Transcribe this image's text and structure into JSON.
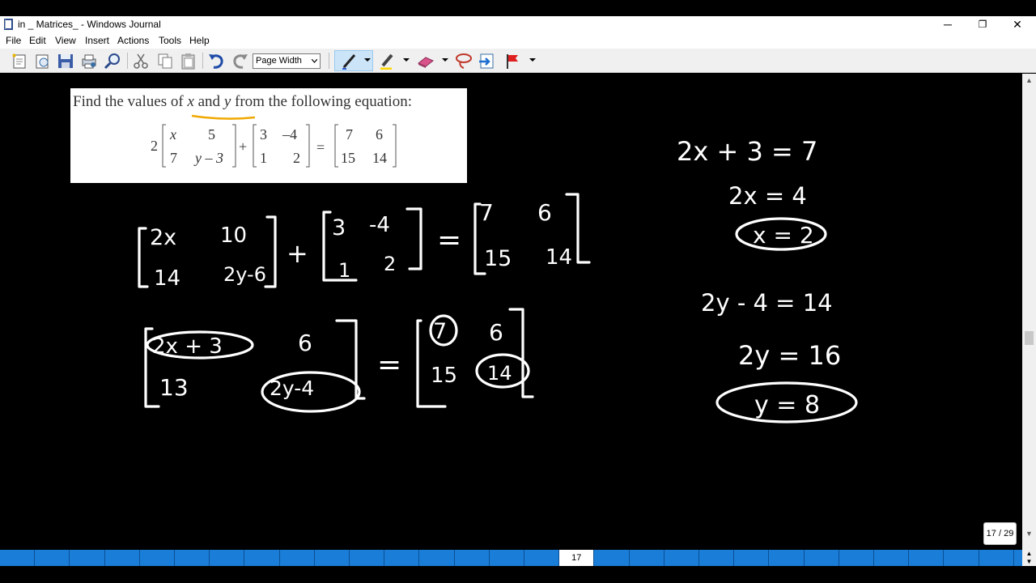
{
  "window": {
    "title": "in _ Matrices_ - Windows Journal",
    "minimize": "─",
    "restore": "❐",
    "close": "✕"
  },
  "menu": [
    "File",
    "Edit",
    "View",
    "Insert",
    "Actions",
    "Tools",
    "Help"
  ],
  "toolbar": {
    "zoom_value": "Page Width",
    "icons": [
      "new-note-icon",
      "open-icon",
      "save-icon",
      "print-icon",
      "find-icon",
      "cut-icon",
      "copy-icon",
      "paste-icon",
      "undo-icon",
      "redo-icon",
      "pen-icon",
      "highlighter-icon",
      "eraser-icon",
      "lasso-icon",
      "insert-space-icon",
      "flag-icon"
    ],
    "colors": {
      "pen_active_bg": "#cce4f7",
      "highlighter": "#ffd700",
      "eraser": "#d9538a",
      "lasso": "#c0392b",
      "flag": "#e02020"
    }
  },
  "problem": {
    "prompt_pre": "Find the values of ",
    "var_x": "x",
    "and": " and ",
    "var_y": "y",
    "prompt_post": " from the following equation:",
    "scalar": "2",
    "m1": [
      "x",
      "5",
      "7",
      "y – 3"
    ],
    "plus": "+",
    "m2": [
      "3",
      "–4",
      "1",
      "2"
    ],
    "equals": "=",
    "m3": [
      "7",
      "6",
      "15",
      "14"
    ]
  },
  "handwriting": {
    "line1": {
      "a": [
        "2x",
        "10",
        "14",
        "2y-6"
      ],
      "plus": "+",
      "b": [
        "3",
        "-4",
        "1",
        "2"
      ],
      "equals": "=",
      "c": [
        "7",
        "6",
        "15",
        "14"
      ]
    },
    "line2": {
      "a": [
        "2x + 3",
        "6",
        "13",
        "2y-4"
      ],
      "equals": "=",
      "c": [
        "7",
        "6",
        "15",
        "14"
      ]
    },
    "solve_x": [
      "2x + 3  =  7",
      "2x = 4",
      "x = 2"
    ],
    "solve_y": [
      "2y  -  4  =  14",
      "2y  = 16",
      "y = 8"
    ]
  },
  "status": {
    "page_indicator": "17 / 29",
    "current_page": "17",
    "bar_color": "#1a7dd7"
  }
}
